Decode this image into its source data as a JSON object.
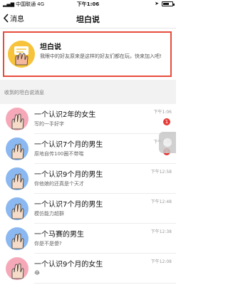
{
  "status_bar": {
    "carrier": "中国联通",
    "network": "4G",
    "time": "下午1:06"
  },
  "nav": {
    "back_label": "消息",
    "title": "坦白说"
  },
  "promo": {
    "name": "坦白说",
    "description": "我眼中的好友原来是这样的好友们都在玩，快来加入吧!"
  },
  "section_label": "收到的坦白说消息",
  "messages": [
    {
      "title": "一个认识2年的女生",
      "subtitle": "写的一手好字",
      "time": "下午1:06",
      "badge": "1",
      "avatar": "pink"
    },
    {
      "title": "一个认识7个月的男生",
      "subtitle": "原地自传100圈不带喘",
      "time": "下午1:05",
      "badge": "1",
      "avatar": "blue"
    },
    {
      "title": "一个认识9个月的男生",
      "subtitle": "你他娘的还真是个天才",
      "time": "下午12:58",
      "badge": "",
      "avatar": "blue"
    },
    {
      "title": "一个认识7个月的男生",
      "subtitle": "模仿能力超群",
      "time": "下午12:48",
      "badge": "",
      "avatar": "blue"
    },
    {
      "title": "一个马赛的男生",
      "subtitle": "你是不是傻?",
      "time": "下午12:38",
      "badge": "",
      "avatar": "blue"
    },
    {
      "title": "一个认识9个月的女生",
      "subtitle": "😂",
      "time": "下午12:08",
      "badge": "",
      "avatar": "pink"
    }
  ],
  "colors": {
    "highlight_border": "#e74c3c",
    "badge": "#e53935",
    "pink": "#f5a9b8",
    "blue": "#8bb8f0",
    "logo": "#f6c33b"
  },
  "icons": {
    "back": "chevron-left-icon",
    "avatar": "hand-gesture-icon"
  }
}
